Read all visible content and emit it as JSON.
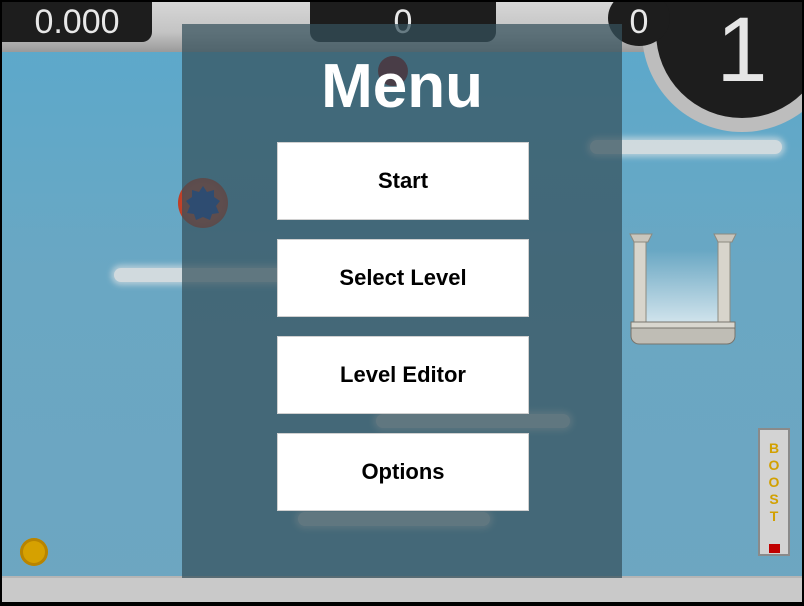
{
  "hud": {
    "time": "0.000",
    "score": "0",
    "coins": "0",
    "level": "1"
  },
  "menu": {
    "title": "Menu",
    "buttons": [
      {
        "label": "Start"
      },
      {
        "label": "Select Level"
      },
      {
        "label": "Level Editor"
      },
      {
        "label": "Options"
      }
    ]
  },
  "boost": {
    "letters": [
      "B",
      "O",
      "O",
      "S",
      "T"
    ],
    "level": 0.1
  },
  "colors": {
    "sky": "#5aa9cc",
    "overlay": "#34505c",
    "ball": "#c8442a",
    "ball_core": "#1e43a8",
    "boost_text": "#d2a000",
    "hud_bg": "#1d1d1d"
  },
  "icons": [
    "ball",
    "goal-pillars",
    "coin",
    "boost-meter"
  ]
}
